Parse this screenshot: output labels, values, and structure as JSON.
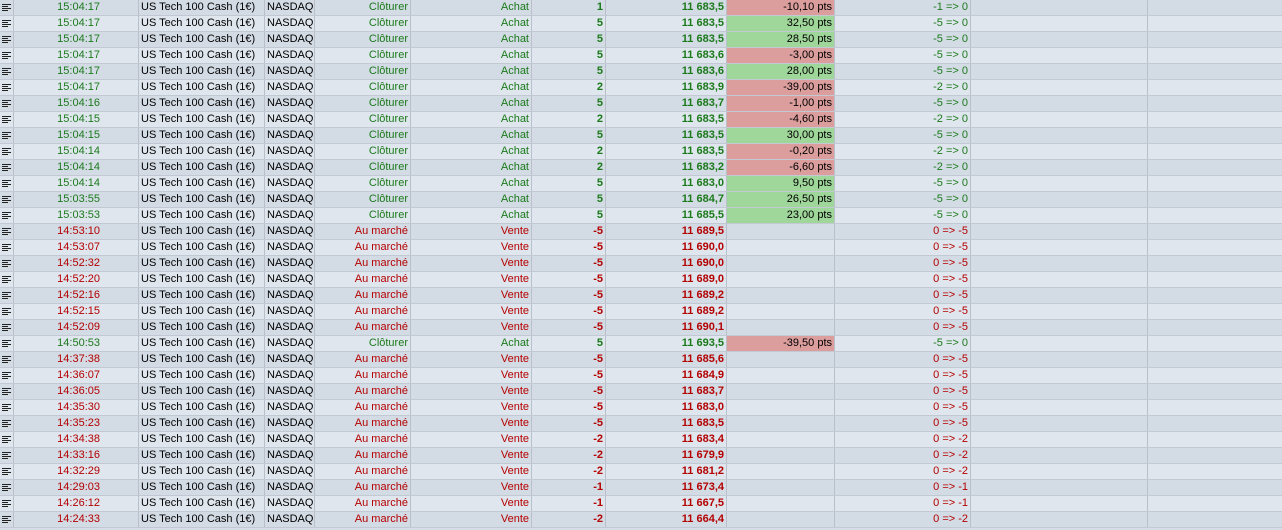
{
  "rows": [
    {
      "time": "15:04:17",
      "instrument": "US Tech 100 Cash (1€)",
      "market": "NASDAQ",
      "type": "Clôturer",
      "side": "Achat",
      "qty": "1",
      "price": "11 683,5",
      "pl": "-10,10 pts",
      "pl_sign": "neg",
      "position": "-1 => 0",
      "color": "green"
    },
    {
      "time": "15:04:17",
      "instrument": "US Tech 100 Cash (1€)",
      "market": "NASDAQ",
      "type": "Clôturer",
      "side": "Achat",
      "qty": "5",
      "price": "11 683,5",
      "pl": "32,50 pts",
      "pl_sign": "pos",
      "position": "-5 => 0",
      "color": "green"
    },
    {
      "time": "15:04:17",
      "instrument": "US Tech 100 Cash (1€)",
      "market": "NASDAQ",
      "type": "Clôturer",
      "side": "Achat",
      "qty": "5",
      "price": "11 683,5",
      "pl": "28,50 pts",
      "pl_sign": "pos",
      "position": "-5 => 0",
      "color": "green"
    },
    {
      "time": "15:04:17",
      "instrument": "US Tech 100 Cash (1€)",
      "market": "NASDAQ",
      "type": "Clôturer",
      "side": "Achat",
      "qty": "5",
      "price": "11 683,6",
      "pl": "-3,00 pts",
      "pl_sign": "neg",
      "position": "-5 => 0",
      "color": "green"
    },
    {
      "time": "15:04:17",
      "instrument": "US Tech 100 Cash (1€)",
      "market": "NASDAQ",
      "type": "Clôturer",
      "side": "Achat",
      "qty": "5",
      "price": "11 683,6",
      "pl": "28,00 pts",
      "pl_sign": "pos",
      "position": "-5 => 0",
      "color": "green"
    },
    {
      "time": "15:04:17",
      "instrument": "US Tech 100 Cash (1€)",
      "market": "NASDAQ",
      "type": "Clôturer",
      "side": "Achat",
      "qty": "2",
      "price": "11 683,9",
      "pl": "-39,00 pts",
      "pl_sign": "neg",
      "position": "-2 => 0",
      "color": "green"
    },
    {
      "time": "15:04:16",
      "instrument": "US Tech 100 Cash (1€)",
      "market": "NASDAQ",
      "type": "Clôturer",
      "side": "Achat",
      "qty": "5",
      "price": "11 683,7",
      "pl": "-1,00 pts",
      "pl_sign": "neg",
      "position": "-5 => 0",
      "color": "green"
    },
    {
      "time": "15:04:15",
      "instrument": "US Tech 100 Cash (1€)",
      "market": "NASDAQ",
      "type": "Clôturer",
      "side": "Achat",
      "qty": "2",
      "price": "11 683,5",
      "pl": "-4,60 pts",
      "pl_sign": "neg",
      "position": "-2 => 0",
      "color": "green"
    },
    {
      "time": "15:04:15",
      "instrument": "US Tech 100 Cash (1€)",
      "market": "NASDAQ",
      "type": "Clôturer",
      "side": "Achat",
      "qty": "5",
      "price": "11 683,5",
      "pl": "30,00 pts",
      "pl_sign": "pos",
      "position": "-5 => 0",
      "color": "green"
    },
    {
      "time": "15:04:14",
      "instrument": "US Tech 100 Cash (1€)",
      "market": "NASDAQ",
      "type": "Clôturer",
      "side": "Achat",
      "qty": "2",
      "price": "11 683,5",
      "pl": "-0,20 pts",
      "pl_sign": "neg",
      "position": "-2 => 0",
      "color": "green"
    },
    {
      "time": "15:04:14",
      "instrument": "US Tech 100 Cash (1€)",
      "market": "NASDAQ",
      "type": "Clôturer",
      "side": "Achat",
      "qty": "2",
      "price": "11 683,2",
      "pl": "-6,60 pts",
      "pl_sign": "neg",
      "position": "-2 => 0",
      "color": "green"
    },
    {
      "time": "15:04:14",
      "instrument": "US Tech 100 Cash (1€)",
      "market": "NASDAQ",
      "type": "Clôturer",
      "side": "Achat",
      "qty": "5",
      "price": "11 683,0",
      "pl": "9,50 pts",
      "pl_sign": "pos",
      "position": "-5 => 0",
      "color": "green"
    },
    {
      "time": "15:03:55",
      "instrument": "US Tech 100 Cash (1€)",
      "market": "NASDAQ",
      "type": "Clôturer",
      "side": "Achat",
      "qty": "5",
      "price": "11 684,7",
      "pl": "26,50 pts",
      "pl_sign": "pos",
      "position": "-5 => 0",
      "color": "green"
    },
    {
      "time": "15:03:53",
      "instrument": "US Tech 100 Cash (1€)",
      "market": "NASDAQ",
      "type": "Clôturer",
      "side": "Achat",
      "qty": "5",
      "price": "11 685,5",
      "pl": "23,00 pts",
      "pl_sign": "pos",
      "position": "-5 => 0",
      "color": "green"
    },
    {
      "time": "14:53:10",
      "instrument": "US Tech 100 Cash (1€)",
      "market": "NASDAQ",
      "type": "Au marché",
      "side": "Vente",
      "qty": "-5",
      "price": "11 689,5",
      "pl": "",
      "pl_sign": "none",
      "position": "0 => -5",
      "color": "red"
    },
    {
      "time": "14:53:07",
      "instrument": "US Tech 100 Cash (1€)",
      "market": "NASDAQ",
      "type": "Au marché",
      "side": "Vente",
      "qty": "-5",
      "price": "11 690,0",
      "pl": "",
      "pl_sign": "none",
      "position": "0 => -5",
      "color": "red"
    },
    {
      "time": "14:52:32",
      "instrument": "US Tech 100 Cash (1€)",
      "market": "NASDAQ",
      "type": "Au marché",
      "side": "Vente",
      "qty": "-5",
      "price": "11 690,0",
      "pl": "",
      "pl_sign": "none",
      "position": "0 => -5",
      "color": "red"
    },
    {
      "time": "14:52:20",
      "instrument": "US Tech 100 Cash (1€)",
      "market": "NASDAQ",
      "type": "Au marché",
      "side": "Vente",
      "qty": "-5",
      "price": "11 689,0",
      "pl": "",
      "pl_sign": "none",
      "position": "0 => -5",
      "color": "red"
    },
    {
      "time": "14:52:16",
      "instrument": "US Tech 100 Cash (1€)",
      "market": "NASDAQ",
      "type": "Au marché",
      "side": "Vente",
      "qty": "-5",
      "price": "11 689,2",
      "pl": "",
      "pl_sign": "none",
      "position": "0 => -5",
      "color": "red"
    },
    {
      "time": "14:52:15",
      "instrument": "US Tech 100 Cash (1€)",
      "market": "NASDAQ",
      "type": "Au marché",
      "side": "Vente",
      "qty": "-5",
      "price": "11 689,2",
      "pl": "",
      "pl_sign": "none",
      "position": "0 => -5",
      "color": "red"
    },
    {
      "time": "14:52:09",
      "instrument": "US Tech 100 Cash (1€)",
      "market": "NASDAQ",
      "type": "Au marché",
      "side": "Vente",
      "qty": "-5",
      "price": "11 690,1",
      "pl": "",
      "pl_sign": "none",
      "position": "0 => -5",
      "color": "red"
    },
    {
      "time": "14:50:53",
      "instrument": "US Tech 100 Cash (1€)",
      "market": "NASDAQ",
      "type": "Clôturer",
      "side": "Achat",
      "qty": "5",
      "price": "11 693,5",
      "pl": "-39,50 pts",
      "pl_sign": "neg",
      "position": "-5 => 0",
      "color": "green"
    },
    {
      "time": "14:37:38",
      "instrument": "US Tech 100 Cash (1€)",
      "market": "NASDAQ",
      "type": "Au marché",
      "side": "Vente",
      "qty": "-5",
      "price": "11 685,6",
      "pl": "",
      "pl_sign": "none",
      "position": "0 => -5",
      "color": "red"
    },
    {
      "time": "14:36:07",
      "instrument": "US Tech 100 Cash (1€)",
      "market": "NASDAQ",
      "type": "Au marché",
      "side": "Vente",
      "qty": "-5",
      "price": "11 684,9",
      "pl": "",
      "pl_sign": "none",
      "position": "0 => -5",
      "color": "red"
    },
    {
      "time": "14:36:05",
      "instrument": "US Tech 100 Cash (1€)",
      "market": "NASDAQ",
      "type": "Au marché",
      "side": "Vente",
      "qty": "-5",
      "price": "11 683,7",
      "pl": "",
      "pl_sign": "none",
      "position": "0 => -5",
      "color": "red"
    },
    {
      "time": "14:35:30",
      "instrument": "US Tech 100 Cash (1€)",
      "market": "NASDAQ",
      "type": "Au marché",
      "side": "Vente",
      "qty": "-5",
      "price": "11 683,0",
      "pl": "",
      "pl_sign": "none",
      "position": "0 => -5",
      "color": "red"
    },
    {
      "time": "14:35:23",
      "instrument": "US Tech 100 Cash (1€)",
      "market": "NASDAQ",
      "type": "Au marché",
      "side": "Vente",
      "qty": "-5",
      "price": "11 683,5",
      "pl": "",
      "pl_sign": "none",
      "position": "0 => -5",
      "color": "red"
    },
    {
      "time": "14:34:38",
      "instrument": "US Tech 100 Cash (1€)",
      "market": "NASDAQ",
      "type": "Au marché",
      "side": "Vente",
      "qty": "-2",
      "price": "11 683,4",
      "pl": "",
      "pl_sign": "none",
      "position": "0 => -2",
      "color": "red"
    },
    {
      "time": "14:33:16",
      "instrument": "US Tech 100 Cash (1€)",
      "market": "NASDAQ",
      "type": "Au marché",
      "side": "Vente",
      "qty": "-2",
      "price": "11 679,9",
      "pl": "",
      "pl_sign": "none",
      "position": "0 => -2",
      "color": "red"
    },
    {
      "time": "14:32:29",
      "instrument": "US Tech 100 Cash (1€)",
      "market": "NASDAQ",
      "type": "Au marché",
      "side": "Vente",
      "qty": "-2",
      "price": "11 681,2",
      "pl": "",
      "pl_sign": "none",
      "position": "0 => -2",
      "color": "red"
    },
    {
      "time": "14:29:03",
      "instrument": "US Tech 100 Cash (1€)",
      "market": "NASDAQ",
      "type": "Au marché",
      "side": "Vente",
      "qty": "-1",
      "price": "11 673,4",
      "pl": "",
      "pl_sign": "none",
      "position": "0 => -1",
      "color": "red"
    },
    {
      "time": "14:26:12",
      "instrument": "US Tech 100 Cash (1€)",
      "market": "NASDAQ",
      "type": "Au marché",
      "side": "Vente",
      "qty": "-1",
      "price": "11 667,5",
      "pl": "",
      "pl_sign": "none",
      "position": "0 => -1",
      "color": "red"
    },
    {
      "time": "14:24:33",
      "instrument": "US Tech 100 Cash (1€)",
      "market": "NASDAQ",
      "type": "Au marché",
      "side": "Vente",
      "qty": "-2",
      "price": "11 664,4",
      "pl": "",
      "pl_sign": "none",
      "position": "0 => -2",
      "color": "red"
    }
  ],
  "colors": {
    "buy_text": "#1a7a1a",
    "sell_text": "#b40000",
    "profit_bg": "#9fd69a",
    "loss_bg": "#dc9d9d"
  },
  "row_icon": "document-lines-icon"
}
